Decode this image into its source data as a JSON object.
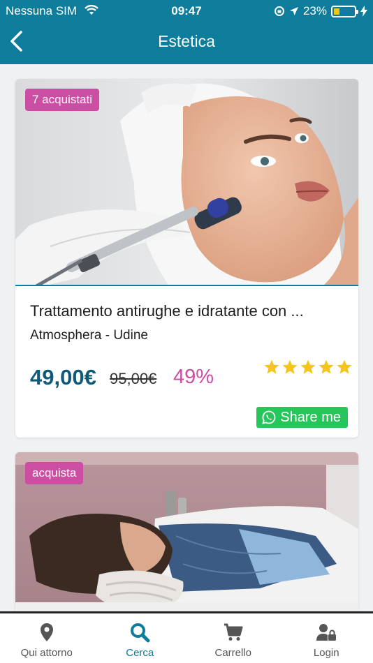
{
  "status_bar": {
    "carrier": "Nessuna SIM",
    "time": "09:47",
    "battery_percent": "23%",
    "battery_level": 0.23
  },
  "header": {
    "title": "Estetica",
    "back_icon": "chevron-left-icon",
    "bg_color": "#0e7d9b"
  },
  "deals": [
    {
      "badge": "7 acquistati",
      "title": "Trattamento antirughe e idratante con ...",
      "merchant": "Atmosphera - Udine",
      "price": "49,00€",
      "old_price": "95,00€",
      "discount": "49%",
      "rating": 5,
      "share_label": "Share me"
    },
    {
      "badge": "acquista"
    }
  ],
  "tabbar": {
    "items": [
      {
        "label": "Qui attorno",
        "icon": "map-pin-icon",
        "active": false
      },
      {
        "label": "Cerca",
        "icon": "search-icon",
        "active": true
      },
      {
        "label": "Carrello",
        "icon": "cart-icon",
        "active": false
      },
      {
        "label": "Login",
        "icon": "user-lock-icon",
        "active": false
      }
    ]
  },
  "colors": {
    "accent": "#0e7d9b",
    "badge": "#cc4ea3",
    "price": "#0e5a78",
    "star": "#f5c518",
    "share": "#27c65a"
  }
}
